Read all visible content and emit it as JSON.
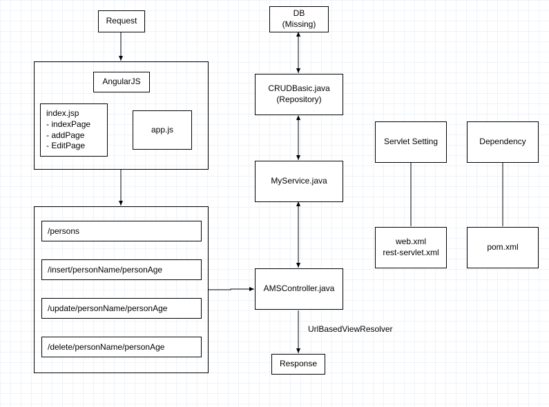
{
  "request": {
    "label": "Request"
  },
  "frontend": {
    "angular": "AngularJS",
    "index": {
      "title": "index.jsp",
      "items": [
        "- indexPage",
        "- addPage",
        "- EditPage"
      ]
    },
    "appjs": "app.js"
  },
  "endpoints": {
    "rows": [
      "/persons",
      "/insert/personName/personAge",
      "/update/personName/personAge",
      "/delete/personName/personAge"
    ]
  },
  "middle": {
    "db": "DB\n(Missing)",
    "repository": "CRUDBasic.java\n(Repository)",
    "service": "MyService.java",
    "controller": "AMSController.java",
    "resolver": "UrlBasedViewResolver",
    "response": "Response"
  },
  "servlet": {
    "top": "Servlet Setting",
    "bottom": "web.xml\nrest-servlet.xml"
  },
  "dependency": {
    "top": "Dependency",
    "bottom": "pom.xml"
  }
}
